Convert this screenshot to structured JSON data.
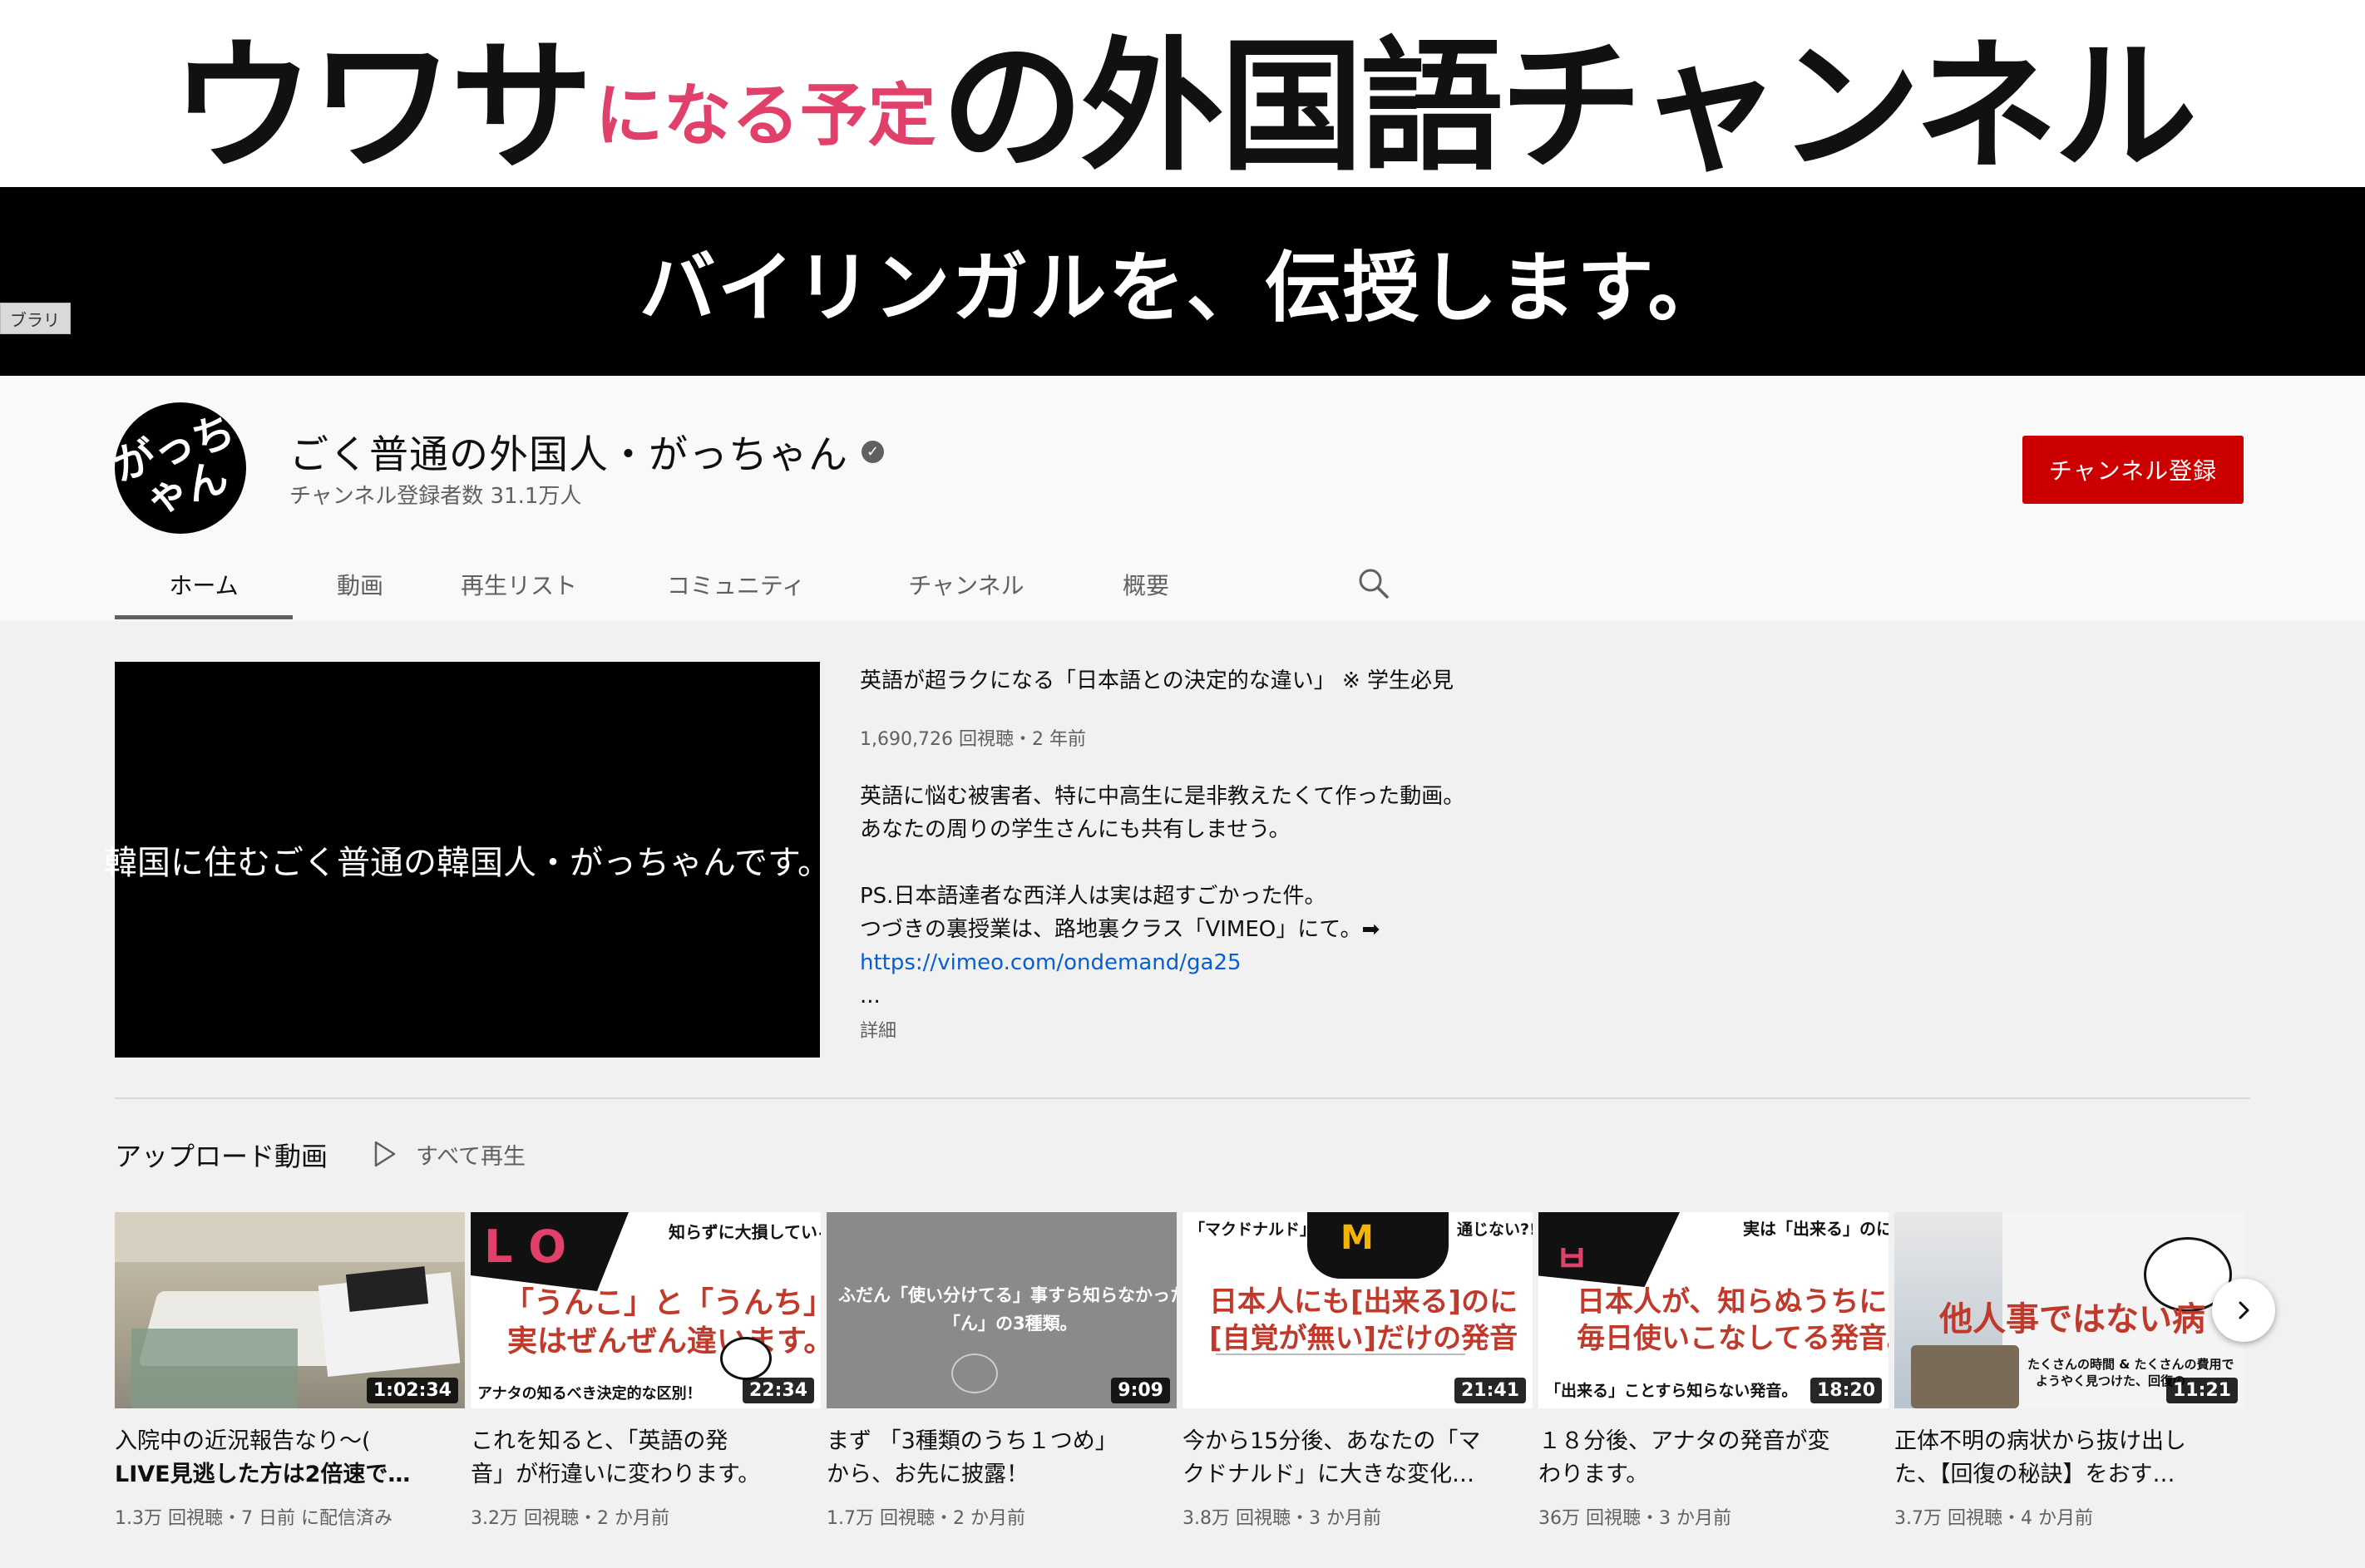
{
  "banner": {
    "title_part1": "ウワサ",
    "title_part2": "になる予定",
    "title_part3": "の外国語チャンネル",
    "subtitle": "バイリンガルを、伝授します。",
    "library_tab": "ブラリ"
  },
  "channel": {
    "avatar_text": "がっちゃん",
    "name": "ごく普通の外国人・がっちゃん",
    "subscribers": "チャンネル登録者数 31.1万人",
    "subscribe_label": "チャンネル登録"
  },
  "tabs": [
    {
      "label": "ホーム",
      "active": true
    },
    {
      "label": "動画"
    },
    {
      "label": "再生リスト"
    },
    {
      "label": "コミュニティ"
    },
    {
      "label": "チャンネル"
    },
    {
      "label": "概要"
    }
  ],
  "featured": {
    "player_text": "韓国に住むごく普通の韓国人・がっちゃんです。",
    "title": "英語が超ラクになる「日本語との決定的な違い」 ※ 学生必見",
    "meta": "1,690,726 回視聴・2 年前",
    "description": [
      "英語に悩む被害者、特に中高生に是非教えたくて作った動画。",
      "あなたの周りの学生さんにも共有しませう。",
      "",
      "PS.日本語達者な西洋人は実は超すごかった件。",
      "つづきの裏授業は、路地裏クラス「VIMEO」にて。➡"
    ],
    "link": "https://vimeo.com/ondemand/ga25",
    "ellipsis": "...",
    "more_label": "詳細"
  },
  "uploads": {
    "title": "アップロード動画",
    "play_all": "すべて再生",
    "videos": [
      {
        "title_line1": "入院中の近況報告なり〜(",
        "title_line2": "LIVE見逃した方は2倍速で…",
        "meta": "1.3万 回視聴・7 日前 に配信済み",
        "duration": "1:02:34"
      },
      {
        "title_line1": "これを知ると、「英語の発",
        "title_line2": "音」が桁違いに変わります。",
        "meta": "3.2万 回視聴・2 か月前",
        "duration": "22:34",
        "thumb_top": "知らずに大損している",
        "thumb_main1": "「うんこ」と「うんち」",
        "thumb_main2": "実はぜんぜん違います。",
        "thumb_bottom": "アナタの知るべき決定的な区別！"
      },
      {
        "title_line1": "まず 「3種類のうち１つめ」",
        "title_line2": "から、お先に披露！",
        "meta": "1.7万 回視聴・2 か月前",
        "duration": "9:09",
        "thumb_main1": "ふだん「使い分けてる」事すら知らなかった",
        "thumb_main2": "「ん」の3種類。"
      },
      {
        "title_line1": "今から15分後、あなたの「マ",
        "title_line2": "クドナルド」に大きな変化…",
        "meta": "3.8万 回視聴・3 か月前",
        "duration": "21:41",
        "thumb_top_left": "「マクドナルド」が",
        "thumb_top_right": "通じない?!",
        "thumb_main1": "日本人にも[出来る]のに",
        "thumb_main2": "[自覚が無い]だけの発音"
      },
      {
        "title_line1": "１８分後、アナタの発音が変",
        "title_line2": "わります。",
        "meta": "36万 回視聴・3 か月前",
        "duration": "18:20",
        "thumb_top": "実は「出来る」のに",
        "thumb_main1": "日本人が、知らぬうちに",
        "thumb_main2": "毎日使いこなしてる発音。",
        "thumb_bottom": "「出来る」ことすら知らない発音。"
      },
      {
        "title_line1": "正体不明の病状から抜け出し",
        "title_line2": "た、【回復の秘訣】をおす…",
        "meta": "3.7万 回視聴・4 か月前",
        "duration": "11:21",
        "thumb_main1": "他人事ではない病",
        "thumb_sub1": "たくさんの時間 & たくさんの費用で",
        "thumb_sub2": "ようやく見つけた、回復の"
      }
    ]
  },
  "colors": {
    "subscribe": "#cc0000",
    "link": "#065fd4",
    "banner_accent": "#e0406a"
  },
  "icons": [
    "verified-badge-icon",
    "search-icon",
    "play-icon",
    "chevron-right-icon"
  ]
}
